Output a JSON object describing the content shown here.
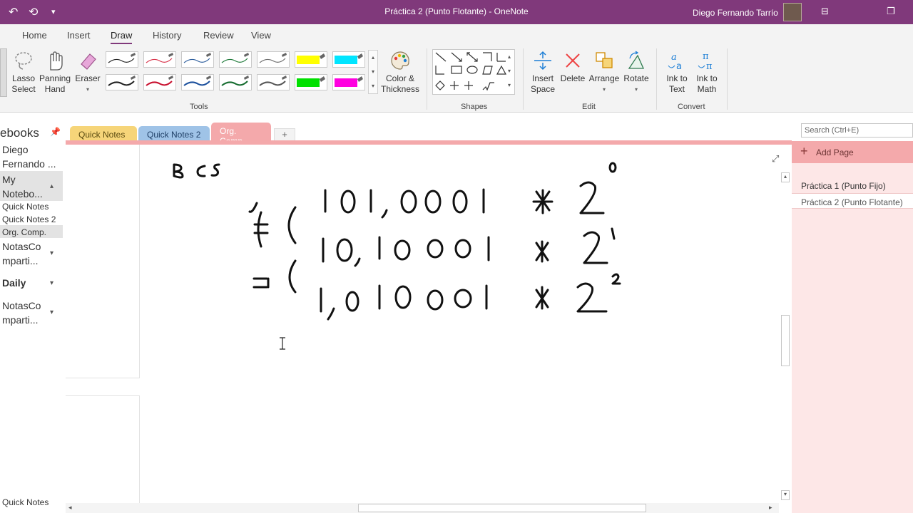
{
  "titlebar": {
    "title": "Práctica 2 (Punto Flotante)  -  OneNote",
    "user": "Diego Fernando Tarrío",
    "undo_icon": "↶",
    "redo_icon": "⟲",
    "dropdown_icon": "▾",
    "ribbon_display_icon": "⊟",
    "restore_icon": "❐"
  },
  "ribbon_tabs": [
    "Home",
    "Insert",
    "Draw",
    "History",
    "Review",
    "View"
  ],
  "tools": {
    "lasso": "Lasso Select",
    "panning": "Panning Hand",
    "eraser": "Eraser",
    "color_thickness": "Color & Thickness",
    "group": "Tools",
    "pen_colors": [
      "#222222",
      "#d9354c",
      "#2f5f9e",
      "#1f7a3a",
      "#6e6e6e",
      "#222222",
      "#c8102e",
      "#1b4f9c",
      "#146b2e",
      "#555555"
    ],
    "highlighter_colors": [
      "#ffff00",
      "#00e5ff",
      "#00e000",
      "#ff00e0"
    ]
  },
  "shapes": {
    "group": "Shapes"
  },
  "edit": {
    "insert_space": "Insert Space",
    "delete": "Delete",
    "arrange": "Arrange",
    "rotate": "Rotate",
    "group": "Edit"
  },
  "convert": {
    "ink_to_text": "Ink to Text",
    "ink_to_math": "Ink to Math",
    "group": "Convert"
  },
  "nav": {
    "header": "ebooks",
    "pin_icon": "📌",
    "owner": "Diego Fernando ...",
    "my_notebook": "My Notebo...",
    "sections": [
      "Quick Notes",
      "Quick Notes 2",
      "Org. Comp."
    ],
    "notascomp1": "NotasCo mparti...",
    "daily": "Daily",
    "notascomp2": "NotasCo mparti...",
    "footer": "Quick Notes"
  },
  "section_tabs": [
    {
      "label": "Quick Notes",
      "color": "#f6d579"
    },
    {
      "label": "Quick Notes 2",
      "color": "#9fc3e7"
    },
    {
      "label": "Org. Comp.",
      "color": "#f4a9ab"
    }
  ],
  "add_tab": "+",
  "search_placeholder": "Search (Ctrl+E)",
  "pages": {
    "add_page": "Add Page",
    "list": [
      "Práctica 1 (Punto Fijo)",
      "Práctica 2 (Punto Flotante)"
    ]
  },
  "colors": {
    "accent": "#80397b",
    "section": "#f4a9ab",
    "pages_bg": "#fde7e7"
  }
}
